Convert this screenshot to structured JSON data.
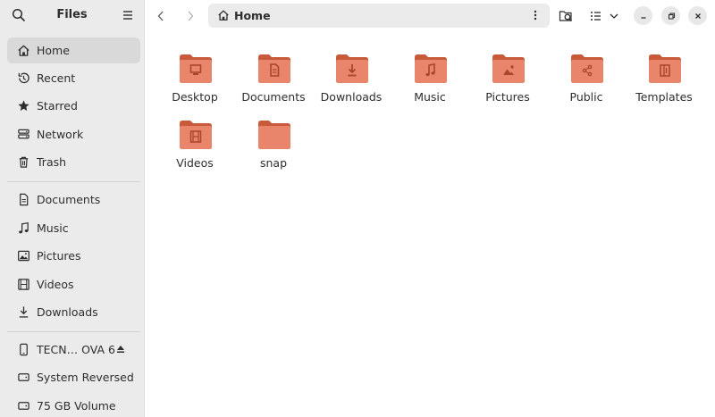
{
  "app": {
    "title": "Files"
  },
  "sidebar": {
    "places": [
      {
        "label": "Home",
        "icon": "home-icon",
        "active": true
      },
      {
        "label": "Recent",
        "icon": "recent-icon"
      },
      {
        "label": "Starred",
        "icon": "star-icon"
      },
      {
        "label": "Network",
        "icon": "network-icon"
      },
      {
        "label": "Trash",
        "icon": "trash-icon"
      }
    ],
    "bookmarks": [
      {
        "label": "Documents",
        "icon": "document-icon"
      },
      {
        "label": "Music",
        "icon": "music-icon"
      },
      {
        "label": "Pictures",
        "icon": "picture-icon"
      },
      {
        "label": "Videos",
        "icon": "video-icon"
      },
      {
        "label": "Downloads",
        "icon": "download-icon"
      }
    ],
    "devices": [
      {
        "label": "TECN…  OVA 6",
        "icon": "phone-icon",
        "ejectable": true
      },
      {
        "label": "System Reversed",
        "icon": "drive-icon"
      },
      {
        "label": "75 GB Volume",
        "icon": "drive-icon"
      }
    ]
  },
  "toolbar": {
    "path": "Home"
  },
  "folders": [
    {
      "label": "Desktop",
      "emblem": "desktop-icon"
    },
    {
      "label": "Documents",
      "emblem": "document-icon"
    },
    {
      "label": "Downloads",
      "emblem": "download-icon"
    },
    {
      "label": "Music",
      "emblem": "music-icon"
    },
    {
      "label": "Pictures",
      "emblem": "picture-icon"
    },
    {
      "label": "Public",
      "emblem": "share-icon"
    },
    {
      "label": "Templates",
      "emblem": "template-icon"
    },
    {
      "label": "Videos",
      "emblem": "video-icon"
    },
    {
      "label": "snap",
      "emblem": ""
    }
  ],
  "colors": {
    "folder_fill": "#e8856a",
    "folder_back": "#c9593b",
    "folder_emblem": "#a8452b",
    "sidebar_bg": "#ebebeb"
  }
}
